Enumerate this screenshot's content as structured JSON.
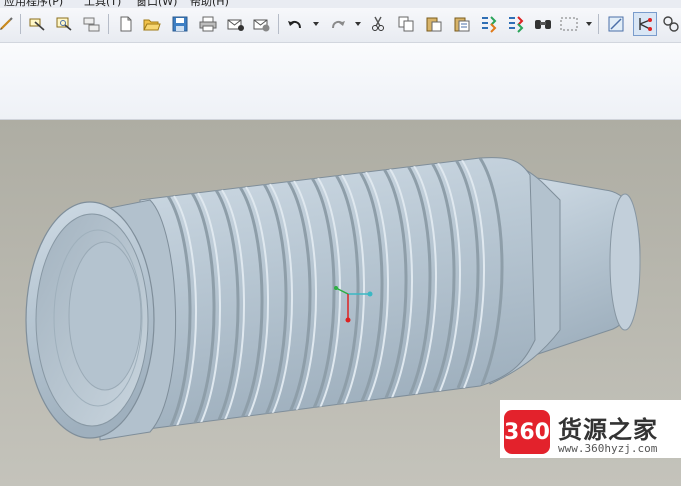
{
  "menu": {
    "items": [
      "应用程序(P)",
      "工具(T)",
      "窗口(W)",
      "帮助(H)"
    ]
  },
  "toolbar": {
    "buttons": [
      {
        "name": "sketch-icon"
      },
      {
        "name": "annotation-edit-icon"
      },
      {
        "name": "annotation-view-icon"
      },
      {
        "name": "annotation-tree-icon"
      },
      {
        "name": "new-file-icon"
      },
      {
        "name": "open-folder-icon"
      },
      {
        "name": "save-icon"
      },
      {
        "name": "print-icon"
      },
      {
        "name": "email-icon"
      },
      {
        "name": "email-attach-icon"
      },
      {
        "name": "undo-icon"
      },
      {
        "name": "redo-icon"
      },
      {
        "name": "cut-icon"
      },
      {
        "name": "copy-icon"
      },
      {
        "name": "paste-icon"
      },
      {
        "name": "paste-special-icon"
      },
      {
        "name": "regenerate-icon"
      },
      {
        "name": "regenerate-manager-icon"
      },
      {
        "name": "find-icon"
      },
      {
        "name": "selection-box-icon"
      },
      {
        "name": "datum-plane-icon"
      },
      {
        "name": "datum-axis-icon"
      },
      {
        "name": "datum-point-icon"
      }
    ]
  },
  "watermark": {
    "logo_text": "360",
    "title": "货源之家",
    "url": "www.360hyzj.com"
  },
  "colors": {
    "viewport_bg": "#bcbcb4",
    "model": "#b9c7d3",
    "watermark_red": "#e3222c"
  }
}
